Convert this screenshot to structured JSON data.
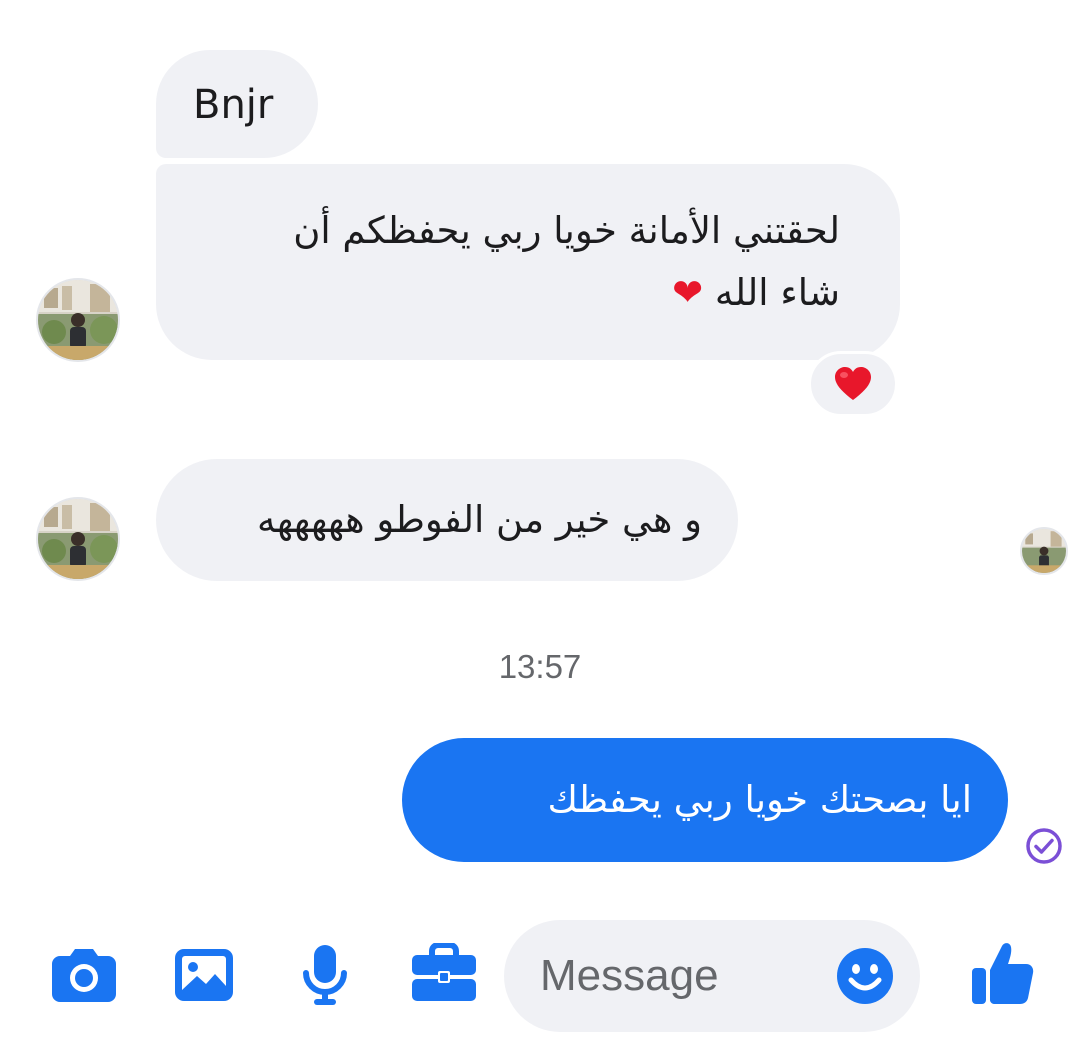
{
  "conversation": {
    "messages": [
      {
        "direction": "incoming",
        "text": "Bnjr"
      },
      {
        "direction": "incoming",
        "line1": "لحقتني الأمانة خويا ربي يحفظكم أن",
        "line2": "شاء الله",
        "emoji": "❤",
        "reaction": "❤"
      },
      {
        "direction": "incoming",
        "text": "و هي خير من الفوطو هههههه"
      },
      {
        "direction": "outgoing",
        "text": "ايا بصحتك خويا ربي يحفظك"
      }
    ],
    "timestamp": "13:57"
  },
  "composer": {
    "placeholder": "Message",
    "icons": [
      "camera-icon",
      "gallery-icon",
      "microphone-icon",
      "briefcase-icon",
      "emoji-icon",
      "like-icon"
    ]
  },
  "colors": {
    "accent": "#1a75f2",
    "incoming_bubble": "#f0f1f5",
    "outgoing_text": "#ffffff",
    "heart": "#e8172b",
    "sent_check": "#7b4fd6",
    "timestamp": "#65676b"
  }
}
